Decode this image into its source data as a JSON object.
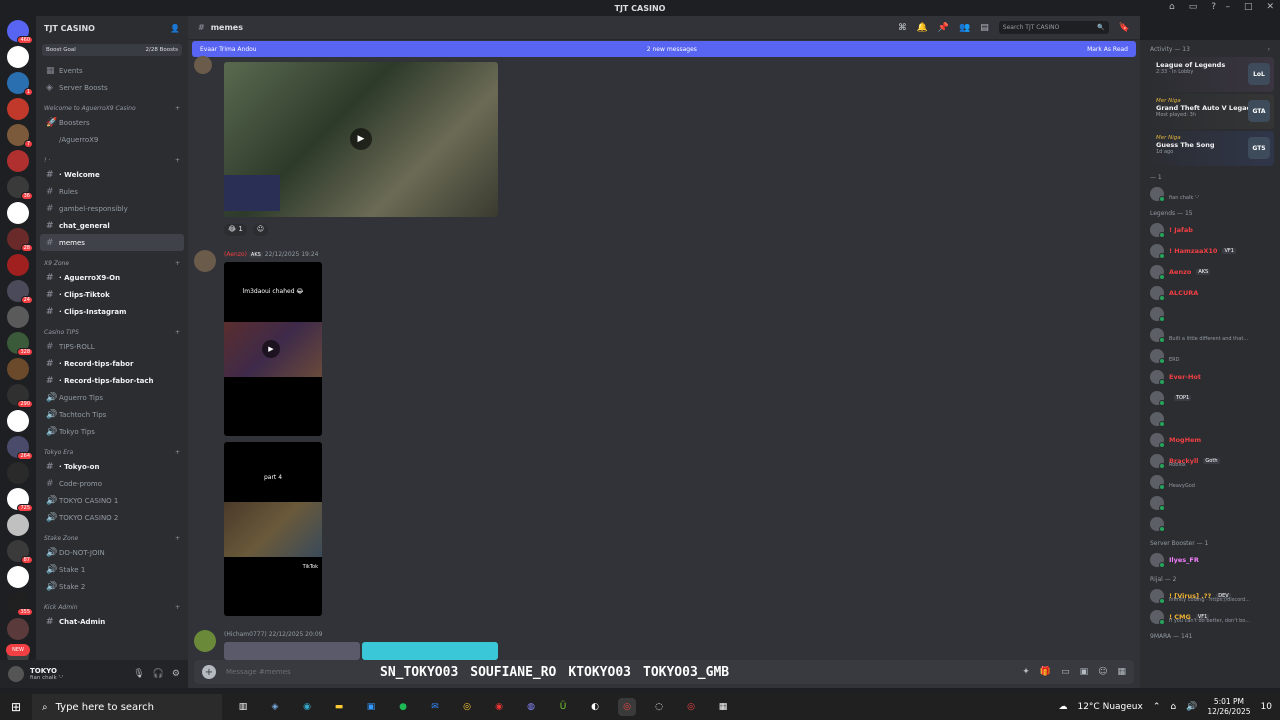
{
  "window": {
    "title": "TJT CASINO"
  },
  "server": {
    "name": "TJT CASINO",
    "boost_label": "Boost Goal",
    "boost_count": "2/28 Boosts"
  },
  "top_items": [
    {
      "label": "Events",
      "icon": "calendar-icon"
    },
    {
      "label": "Server Boosts",
      "icon": "boost-icon"
    }
  ],
  "channels": [
    {
      "type": "cat",
      "label": "Welcome to AguerroX9 Casino"
    },
    {
      "type": "ch",
      "label": "Boosters",
      "prefix": "🚀"
    },
    {
      "type": "ch",
      "label": "/AguerroX9",
      "prefix": ""
    },
    {
      "type": "cat",
      "label": "! ·"
    },
    {
      "type": "ch",
      "label": "· Welcome",
      "prefix": "#",
      "bold": true
    },
    {
      "type": "ch",
      "label": "Rules",
      "prefix": "#"
    },
    {
      "type": "ch",
      "label": "gambel-responsibly",
      "prefix": "#"
    },
    {
      "type": "ch",
      "label": "chat_general",
      "prefix": "#",
      "bold": true
    },
    {
      "type": "ch",
      "label": "memes",
      "prefix": "#",
      "active": true
    },
    {
      "type": "cat",
      "label": "X9 Zone"
    },
    {
      "type": "ch",
      "label": "· AguerroX9-On",
      "prefix": "#",
      "bold": true
    },
    {
      "type": "ch",
      "label": "· Clips-Tiktok",
      "prefix": "#",
      "bold": true
    },
    {
      "type": "ch",
      "label": "· Clips-Instagram",
      "prefix": "#",
      "bold": true
    },
    {
      "type": "cat",
      "label": "Casino TIPS"
    },
    {
      "type": "ch",
      "label": "TIPS-ROLL",
      "prefix": "#"
    },
    {
      "type": "ch",
      "label": "· Record-tips-fabor",
      "prefix": "#",
      "bold": true
    },
    {
      "type": "ch",
      "label": "· Record-tips-fabor-tach",
      "prefix": "#",
      "bold": true
    },
    {
      "type": "ch",
      "label": "Aguerro Tips",
      "prefix": "🔊"
    },
    {
      "type": "ch",
      "label": "Tachtoch Tips",
      "prefix": "🔊"
    },
    {
      "type": "ch",
      "label": "Tokyo Tips",
      "prefix": "🔊"
    },
    {
      "type": "cat",
      "label": "Tokyo Era"
    },
    {
      "type": "ch",
      "label": "· Tokyo-on",
      "prefix": "#",
      "bold": true
    },
    {
      "type": "ch",
      "label": "Code-promo",
      "prefix": "#"
    },
    {
      "type": "ch",
      "label": "TOKYO CASINO 1",
      "prefix": "🔊"
    },
    {
      "type": "ch",
      "label": "TOKYO CASINO 2",
      "prefix": "🔊"
    },
    {
      "type": "cat",
      "label": "Stake Zone"
    },
    {
      "type": "ch",
      "label": "DO-NOT-JOIN",
      "prefix": "🔊"
    },
    {
      "type": "ch",
      "label": "Stake 1",
      "prefix": "🔊"
    },
    {
      "type": "ch",
      "label": "Stake 2",
      "prefix": "🔊"
    },
    {
      "type": "cat",
      "label": "Kick Admin"
    },
    {
      "type": "ch",
      "label": "Chat-Admin",
      "prefix": "#",
      "bold": true
    }
  ],
  "guild_badges": [
    "460",
    "1",
    "7",
    "36",
    "28",
    "24",
    "328",
    "290",
    "264",
    "725",
    "87",
    "355",
    "426",
    "24",
    "965"
  ],
  "new_badge": "NEW",
  "user": {
    "name": "TOKYO",
    "status": "fian chalk '-'"
  },
  "channel": {
    "name": "memes",
    "search_placeholder": "Search TJT CASINO"
  },
  "new_messages": {
    "left": "Evaar Trima Andou",
    "center": "2 new messages",
    "right": "Mark As Read"
  },
  "messages": [
    {
      "author": "",
      "time": "",
      "reactions": [
        "😂 1",
        "☺"
      ]
    },
    {
      "author": "(Aenzo)",
      "tag": "AKS",
      "time": "22/12/2025 19:24",
      "caption1": "lm3daoui chahed 😂",
      "caption2": "part 4",
      "tiktok": "TikTok"
    },
    {
      "author": "(Hicham0777)",
      "time": "22/12/2025 20:09"
    }
  ],
  "input": {
    "placeholder": "Message #memes"
  },
  "overlay": [
    "SN_TOKYO03",
    "SOUFIANE_RO",
    "KTOKYO03",
    "TOKYO03_GMB"
  ],
  "activity": {
    "title": "Activity — 13",
    "items": [
      {
        "name": "",
        "game": "League of Legends",
        "sub": "2:33 · In Lobby",
        "icon": "LoL"
      },
      {
        "name": "Mer Niga",
        "game": "Grand Theft Auto V Legacy",
        "sub": "Most played: 3h",
        "icon": "GTA"
      },
      {
        "name": "Mer Niga",
        "game": "Guess The Song",
        "sub": "1d ago",
        "icon": "GTS"
      }
    ]
  },
  "member_sections": [
    {
      "title": "— 1",
      "members": [
        {
          "name": "",
          "sub": "fian chalk '-'",
          "color": "#dbdee1"
        }
      ]
    },
    {
      "title": "Legends — 15",
      "members": [
        {
          "name": "! Jafab",
          "color": "#f23f43"
        },
        {
          "name": "! HamzaaX10",
          "tag": "VF1",
          "color": "#f23f43"
        },
        {
          "name": "Aenzo",
          "tag": "AKS",
          "color": "#f23f43"
        },
        {
          "name": "ALCURA",
          "color": "#f23f43"
        },
        {
          "name": "",
          "color": "#f23f43"
        },
        {
          "name": "",
          "sub": "Built a little different and that...",
          "color": "#f23f43"
        },
        {
          "name": "",
          "sub": "ERD",
          "color": "#f23f43"
        },
        {
          "name": "Ever-Hot",
          "color": "#f23f43"
        },
        {
          "name": "",
          "tag": "TOP1",
          "color": "#f23f43"
        },
        {
          "name": "",
          "color": "#f23f43"
        },
        {
          "name": "MogHem",
          "color": "#f23f43"
        },
        {
          "name": "Brackyll",
          "tag": "Goth",
          "sub": "Roblox",
          "color": "#f23f43"
        },
        {
          "name": "",
          "sub": "HeavyGod",
          "color": "#f23f43"
        },
        {
          "name": "",
          "color": "#f23f43"
        },
        {
          "name": "",
          "color": "#f23f43"
        }
      ]
    },
    {
      "title": "Server Booster — 1",
      "members": [
        {
          "name": "Ilyes_FR",
          "color": "#f47fff"
        }
      ]
    },
    {
      "title": "Rijal — 2",
      "members": [
        {
          "name": "! [Virus] .??",
          "tag": "DEV",
          "sub": "infinity coding · https://discord...",
          "color": "#f0b232"
        },
        {
          "name": "! CMG",
          "tag": "VF1",
          "sub": "If you can't do better, don't bo...",
          "color": "#f0b232"
        }
      ]
    },
    {
      "title": "9MARA — 141",
      "members": []
    }
  ],
  "taskbar": {
    "search": "Type here to search",
    "weather": "12°C Nuageux",
    "time": "5:01 PM",
    "date": "12/26/2025",
    "notif": "10"
  }
}
